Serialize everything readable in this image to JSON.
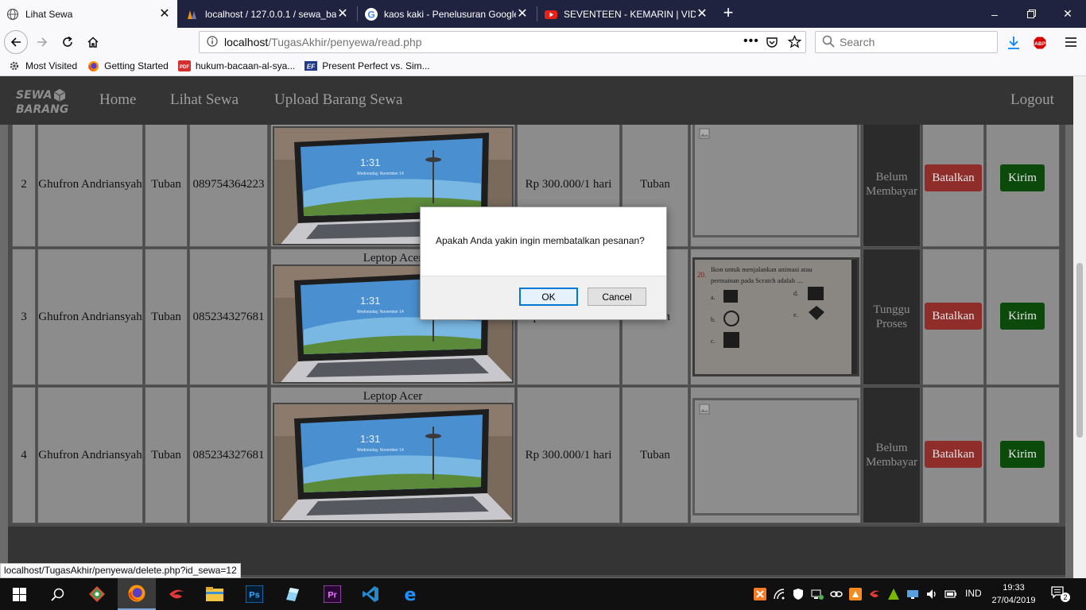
{
  "browser": {
    "tabs": [
      {
        "title": "Lihat Sewa",
        "icon": "globe-icon",
        "active": true
      },
      {
        "title": "localhost / 127.0.0.1 / sewa_bar",
        "icon": "phpmyadmin-icon",
        "active": false
      },
      {
        "title": "kaos kaki - Penelusuran Google",
        "icon": "google-icon",
        "active": false
      },
      {
        "title": "SEVENTEEN - KEMARIN | VIDEO",
        "icon": "youtube-icon",
        "active": false
      }
    ],
    "url": {
      "host": "localhost",
      "path": "/TugasAkhir/penyewa/read.php"
    },
    "search_placeholder": "Search",
    "bookmarks": [
      {
        "label": "Most Visited",
        "icon": "gear-icon"
      },
      {
        "label": "Getting Started",
        "icon": "firefox-icon"
      },
      {
        "label": "hukum-bacaan-al-sya...",
        "icon": "pdf-icon"
      },
      {
        "label": "Present Perfect vs. Sim...",
        "icon": "ef-icon"
      }
    ],
    "status_link": "localhost/TugasAkhir/penyewa/delete.php?id_sewa=12"
  },
  "site": {
    "nav": {
      "logo_line1": "SEWA",
      "logo_line2": "BARANG",
      "home": "Home",
      "lihat": "Lihat Sewa",
      "upload": "Upload Barang Sewa",
      "logout": "Logout"
    },
    "rows": [
      {
        "no": "2",
        "name": "Ghufron Andriansyah",
        "city": "Tuban",
        "phone": "089754364223",
        "item": "",
        "price": "Rp 300.000/1 hari",
        "location": "Tuban",
        "proof": "broken",
        "status": "Belum Membayar",
        "cancel": "Batalkan",
        "send": "Kirim"
      },
      {
        "no": "3",
        "name": "Ghufron Andriansyah",
        "city": "Tuban",
        "phone": "085234327681",
        "item": "Leptop Acer",
        "price": "Rp 300.000/1 hari",
        "location": "Tuban",
        "proof": "photo",
        "status": "Tunggu Proses",
        "cancel": "Batalkan",
        "send": "Kirim"
      },
      {
        "no": "4",
        "name": "Ghufron Andriansyah",
        "city": "Tuban",
        "phone": "085234327681",
        "item": "Leptop Acer",
        "price": "Rp 300.000/1 hari",
        "location": "Tuban",
        "proof": "broken",
        "status": "Belum Membayar",
        "cancel": "Batalkan",
        "send": "Kirim"
      }
    ],
    "worksheet": {
      "number": "20.",
      "line1": "Ikon untuk menjalankan animasi atau",
      "line2": "permainan pada Scratch adalah ....",
      "opts": [
        "a.",
        "b.",
        "c.",
        "d.",
        "e."
      ]
    },
    "laptop_screen": {
      "time": "1:31",
      "date": "Wednesday, November 14"
    }
  },
  "dialog": {
    "message": "Apakah Anda yakin ingin membatalkan pesanan?",
    "ok": "OK",
    "cancel": "Cancel"
  },
  "taskbar": {
    "lang": "IND",
    "time": "19:33",
    "date": "27/04/2019",
    "notifications": "2"
  },
  "colors": {
    "danger": "#d9534f",
    "success": "#1a7f1a",
    "site_nav": "#222222",
    "tab_strip": "#202340"
  }
}
